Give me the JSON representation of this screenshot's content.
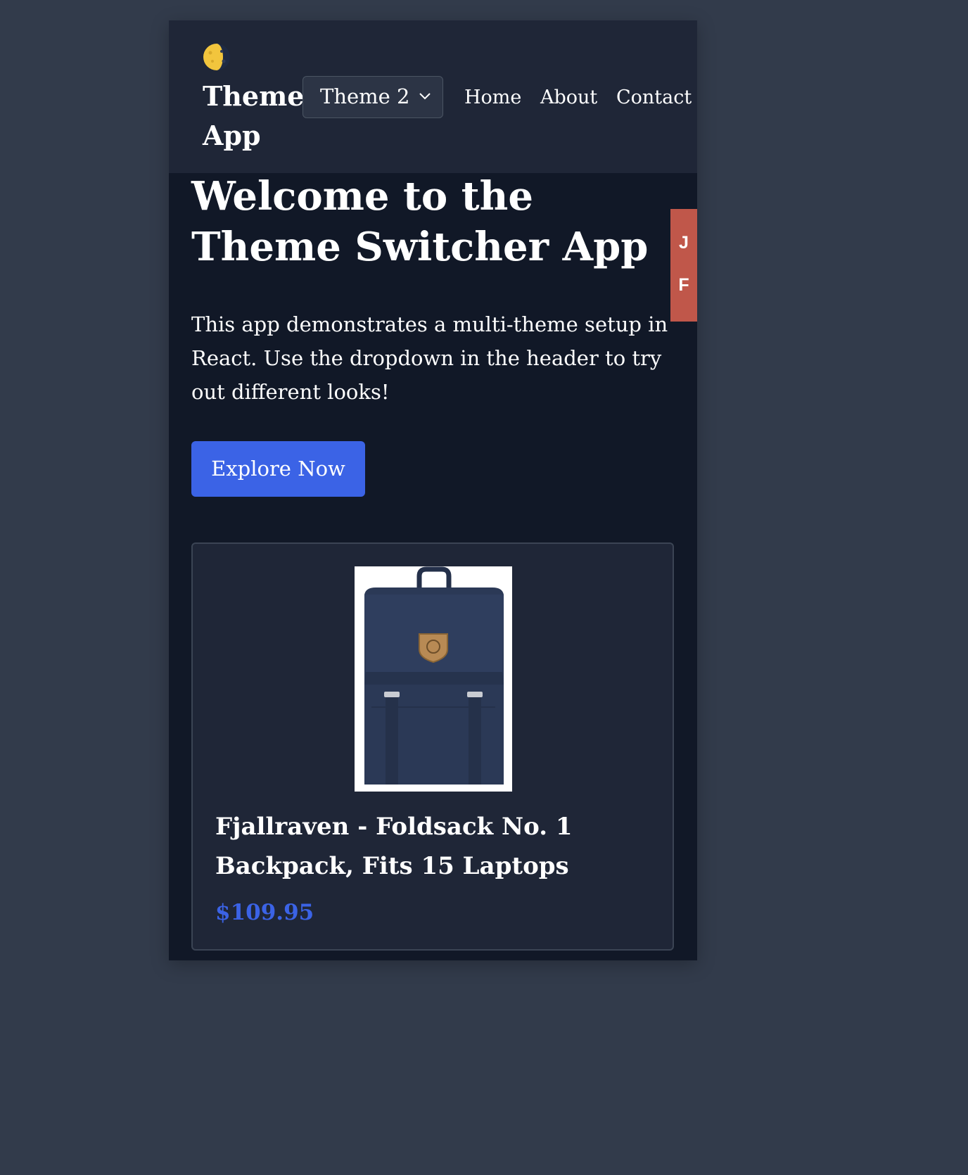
{
  "header": {
    "logo_icon": "moon-phase-icon",
    "brand": "Theme App",
    "theme_select": {
      "value": "Theme 2",
      "icon": "chevron-down-icon"
    },
    "nav": [
      "Home",
      "About",
      "Contact"
    ]
  },
  "side_tab": {
    "letters": [
      "J",
      "F"
    ],
    "color": "#c0574a"
  },
  "hero": {
    "title": "Welcome to the Theme Switcher App",
    "text": "This app demonstrates a multi-theme setup in React. Use the dropdown in the header to try out different looks!",
    "cta_label": "Explore Now"
  },
  "product": {
    "image_icon": "backpack-image",
    "title": "Fjallraven - Foldsack No. 1 Backpack, Fits 15 Laptops",
    "price": "$109.95"
  },
  "colors": {
    "page_background": "#323b4b",
    "app_background": "#111827",
    "header_background": "#1f2637",
    "accent": "#3b63e6",
    "text": "#ffffff"
  }
}
